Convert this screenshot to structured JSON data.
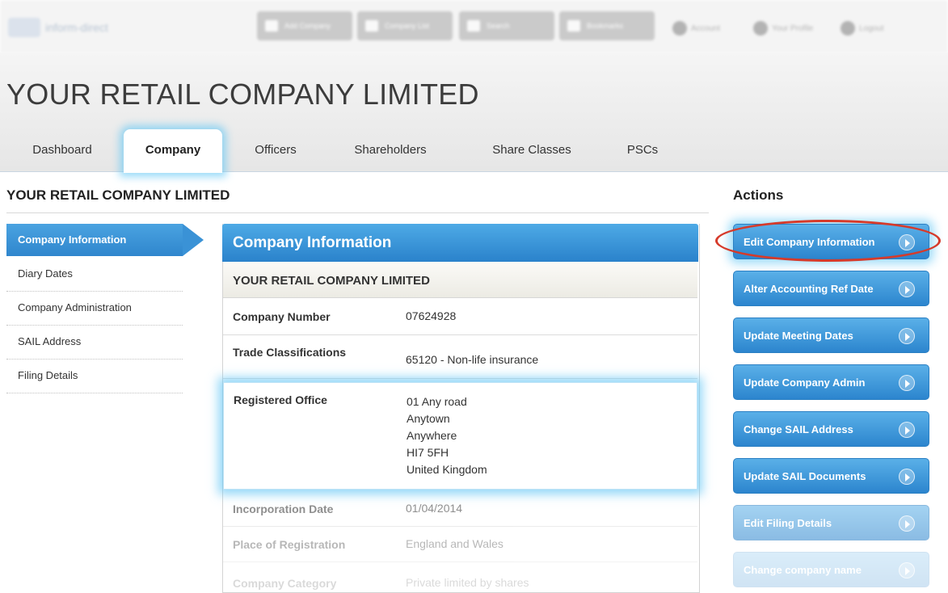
{
  "topbar": {
    "logo_text": "inform-direct",
    "nav_buttons": [
      {
        "label": "Add Company",
        "icon": "add-company-icon"
      },
      {
        "label": "Company List",
        "icon": "company-list-icon"
      },
      {
        "label": "Search",
        "icon": "search-icon"
      },
      {
        "label": "Bookmarks",
        "icon": "bookmark-icon"
      }
    ],
    "account_label": "Account",
    "profile_label": "Your Profile",
    "logout_label": "Logout"
  },
  "company_title": "YOUR RETAIL COMPANY LIMITED",
  "tabs": [
    "Dashboard",
    "Company",
    "Officers",
    "Shareholders",
    "Share Classes",
    "PSCs"
  ],
  "active_tab": "Company",
  "section_title": "YOUR RETAIL COMPANY LIMITED",
  "left_nav": [
    "Company Information",
    "Diary Dates",
    "Company Administration",
    "SAIL Address",
    "Filing Details"
  ],
  "panel": {
    "title": "Company Information",
    "subtitle": "YOUR RETAIL COMPANY LIMITED",
    "rows": [
      {
        "label": "Company Number",
        "value": "07624928"
      },
      {
        "label": "Trade Classifications",
        "value": "65120 - Non-life insurance"
      },
      {
        "label": "Registered Office",
        "lines": [
          "01 Any road",
          "Anytown",
          "Anywhere",
          "HI7 5FH",
          "United Kingdom"
        ]
      },
      {
        "label": "Incorporation Date",
        "value": "01/04/2014"
      },
      {
        "label": "Place of Registration",
        "value": "England and Wales"
      },
      {
        "label": "Company Category",
        "value": "Private limited by shares"
      }
    ]
  },
  "actions": {
    "title": "Actions",
    "buttons": [
      "Edit Company Information",
      "Alter Accounting Ref Date",
      "Update Meeting Dates",
      "Update Company Admin",
      "Change SAIL Address",
      "Update SAIL Documents",
      "Edit Filing Details",
      "Change company name"
    ]
  },
  "colors": {
    "accent_blue": "#2f86cd",
    "highlight_glow": "#66c8f5",
    "annotation_ring": "#d63a2a"
  }
}
